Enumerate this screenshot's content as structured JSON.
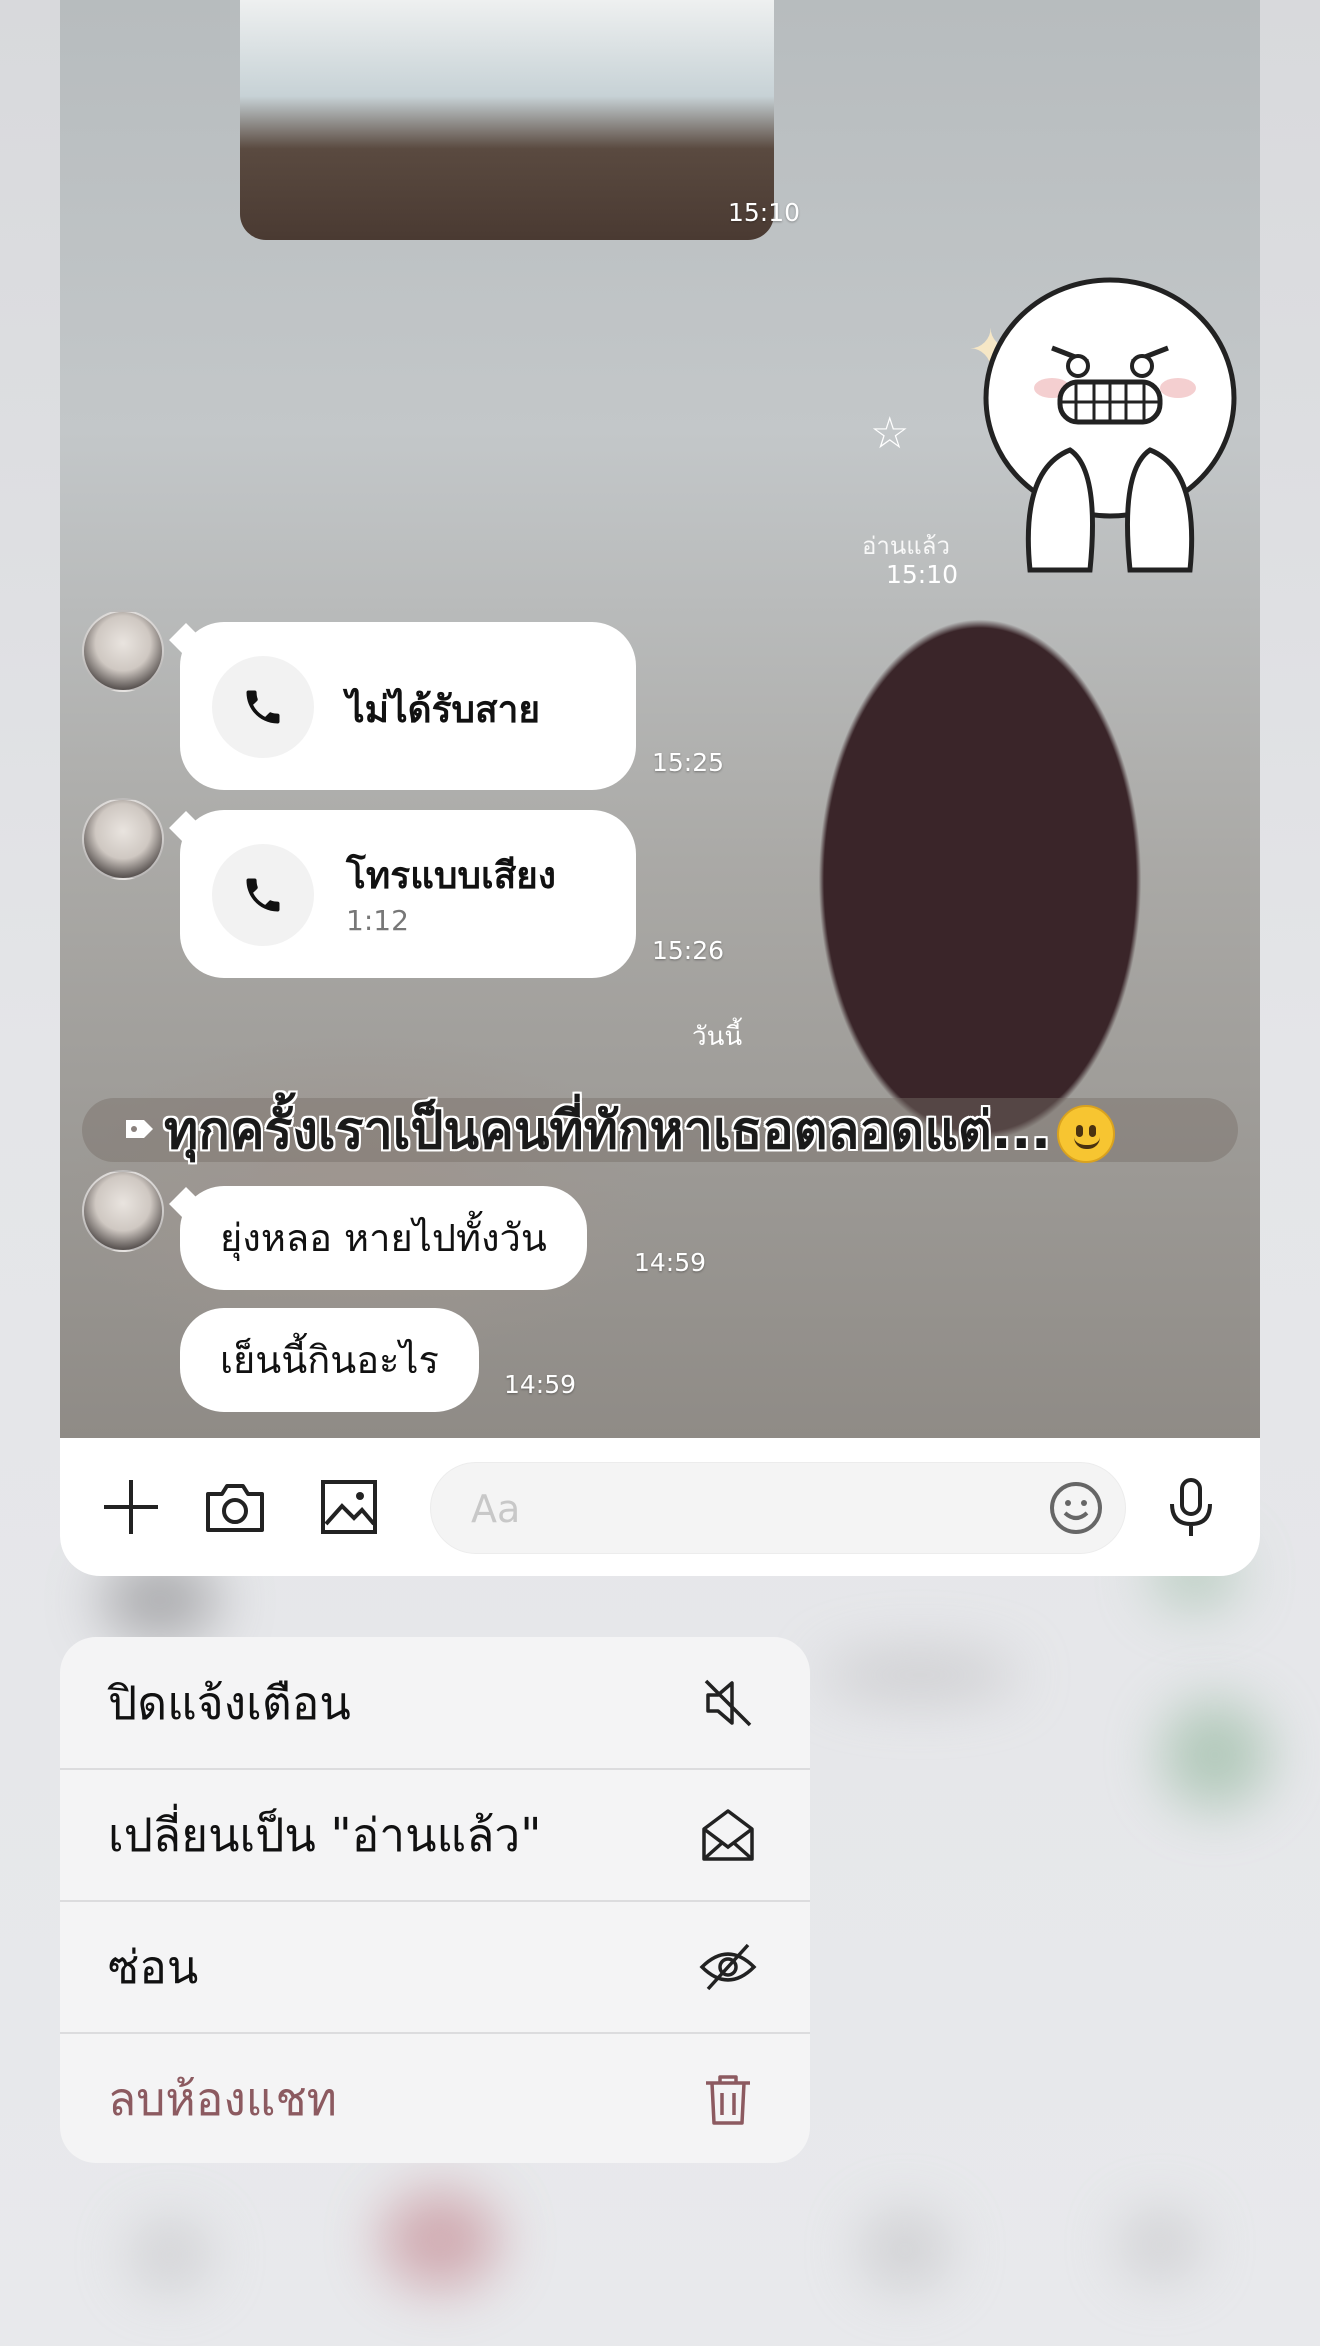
{
  "chat": {
    "photo_time": "15:10",
    "read_label": "อ่านแล้ว",
    "sticker_time": "15:10",
    "calls": [
      {
        "title": "ไม่ได้รับสาย",
        "subtitle": "",
        "time": "15:25"
      },
      {
        "title": "โทรแบบเสียง",
        "subtitle": "1:12",
        "time": "15:26"
      }
    ],
    "date_separator": "วันนี้",
    "announcement": "ทุกครั้งเราเป็นคนที่ทักหาเธอตลอดแต่...",
    "messages": [
      {
        "text": "ยุ่งหลอ หายไปทั้งวัน",
        "time": "14:59"
      },
      {
        "text": "เย็นนี้กินอะไร",
        "time": "14:59"
      }
    ]
  },
  "input_bar": {
    "placeholder": "Aa"
  },
  "context_menu": {
    "items": [
      {
        "label": "ปิดแจ้งเตือน",
        "icon": "mute-icon"
      },
      {
        "label": "เปลี่ยนเป็น \"อ่านแล้ว\"",
        "icon": "open-envelope-icon"
      },
      {
        "label": "ซ่อน",
        "icon": "eye-slash-icon"
      },
      {
        "label": "ลบห้องแชท",
        "icon": "trash-icon",
        "color": "#8c5a60"
      }
    ]
  },
  "colors": {
    "danger": "#8c5a60",
    "menu_bg": "#f4f4f5",
    "bubble": "#ffffff"
  }
}
